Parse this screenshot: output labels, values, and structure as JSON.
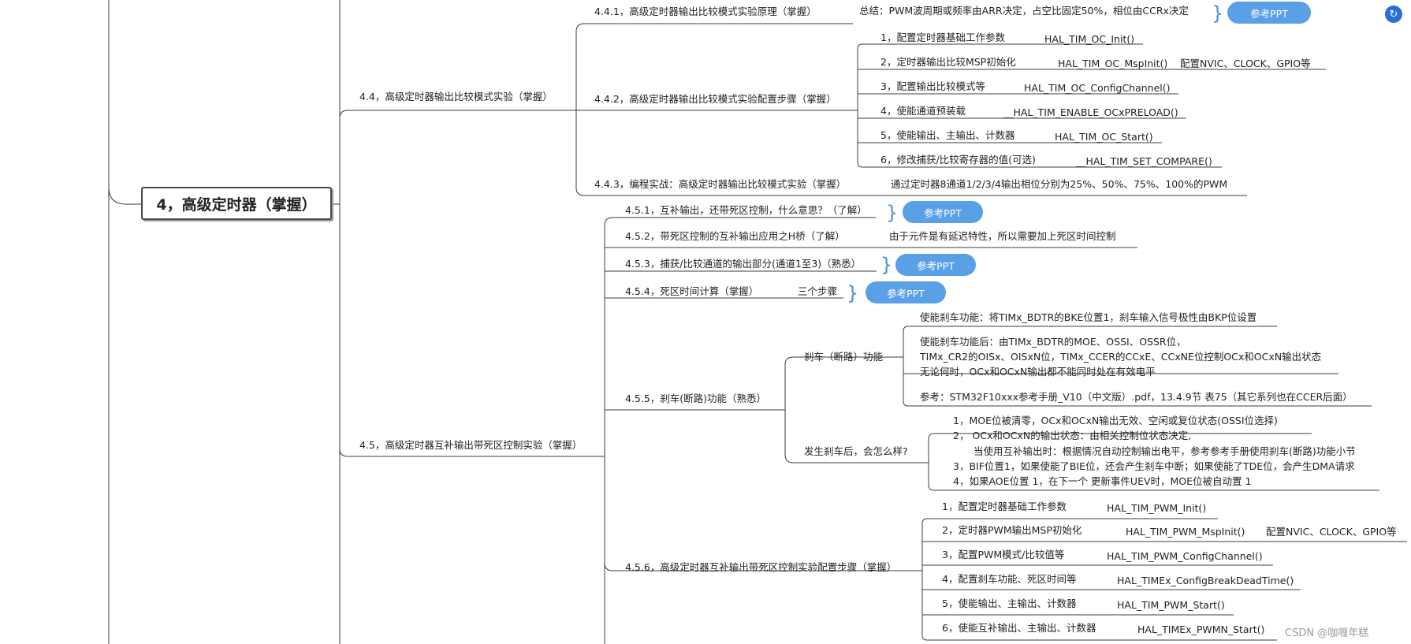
{
  "root": {
    "label": "4，高级定时器（掌握）"
  },
  "s44": {
    "label": "4.4，高级定时器输出比较模式实验（掌握）",
    "n441": {
      "label": "4.4.1，高级定时器输出比较模式实验原理（掌握）",
      "summary": "总结：PWM波周期或频率由ARR决定，占空比固定50%，相位由CCRx决定",
      "ppt": "参考PPT"
    },
    "n442": {
      "label": "4.4.2，高级定时器输出比较模式实验配置步骤（掌握）",
      "steps": [
        {
          "label": "1，配置定时器基础工作参数",
          "func": "HAL_TIM_OC_Init()",
          "note": ""
        },
        {
          "label": "2，定时器输出比较MSP初始化",
          "func": "HAL_TIM_OC_MspInit()",
          "note": "配置NVIC、CLOCK、GPIO等"
        },
        {
          "label": "3，配置输出比较模式等",
          "func": "HAL_TIM_OC_ConfigChannel()",
          "note": ""
        },
        {
          "label": "4，使能通道预装载",
          "func": "__HAL_TIM_ENABLE_OCxPRELOAD()",
          "note": ""
        },
        {
          "label": "5，使能输出、主输出、计数器",
          "func": "HAL_TIM_OC_Start()",
          "note": ""
        },
        {
          "label": "6，修改捕获/比较寄存器的值(可选)",
          "func": "__HAL_TIM_SET_COMPARE()",
          "note": ""
        }
      ]
    },
    "n443": {
      "label": "4.4.3，编程实战：高级定时器输出比较模式实验（掌握）",
      "note": "通过定时器8通道1/2/3/4输出相位分别为25%、50%、75%、100%的PWM"
    }
  },
  "s45": {
    "label": "4.5，高级定时器互补输出带死区控制实验（掌握）",
    "n451": {
      "label": "4.5.1，互补输出，还带死区控制，什么意思？（了解）",
      "ppt": "参考PPT"
    },
    "n452": {
      "label": "4.5.2，带死区控制的互补输出应用之H桥（了解）",
      "note": "由于元件是有延迟特性，所以需要加上死区时间控制"
    },
    "n453": {
      "label": "4.5.3，捕获/比较通道的输出部分(通道1至3)（熟悉）",
      "ppt": "参考PPT"
    },
    "n454": {
      "label": "4.5.4，死区时间计算（掌握）",
      "note": "三个步骤",
      "ppt": "参考PPT"
    },
    "n455": {
      "label": "4.5.5，刹车(断路)功能（熟悉）",
      "brake": {
        "label": "刹车（断路）功能",
        "items": [
          "使能刹车功能：将TIMx_BDTR的BKE位置1，刹车输入信号极性由BKP位设置",
          "使能刹车功能后：由TIMx_BDTR的MOE、OSSI、OSSR位，",
          "TIMx_CR2的OISx、OISxN位，TIMx_CCER的CCxE、CCxNE位控制OCx和OCxN输出状态",
          "无论何时，OCx和OCxN输出都不能同时处在有效电平",
          "参考：STM32F10xxx参考手册_V10（中文版）.pdf，13.4.9节 表75（其它系列也在CCER后面）"
        ]
      },
      "after": {
        "label": "发生刹车后，会怎么样?",
        "items": [
          "1，MOE位被清零，OCx和OCxN输出无效、空闲或复位状态(OSSI位选择)",
          "2，  OCx和OCxN的输出状态：由相关控制位状态决定,",
          "当使用互补输出时：根据情况自动控制输出电平，参考参考手册使用刹车(断路)功能小节",
          "3，BIF位置1，如果使能了BIE位，还会产生刹车中断；如果使能了TDE位，会产生DMA请求",
          "4，如果AOE位置 1，在下一个 更新事件UEV时，MOE位被自动置 1"
        ]
      }
    },
    "n456": {
      "label": "4.5.6，高级定时器互补输出带死区控制实验配置步骤（掌握）",
      "steps": [
        {
          "label": "1，配置定时器基础工作参数",
          "func": "HAL_TIM_PWM_Init()",
          "note": ""
        },
        {
          "label": "2，定时器PWM输出MSP初始化",
          "func": "HAL_TIM_PWM_MspInit()",
          "note": "配置NVIC、CLOCK、GPIO等"
        },
        {
          "label": "3，配置PWM模式/比较值等",
          "func": "HAL_TIM_PWM_ConfigChannel()",
          "note": ""
        },
        {
          "label": "4，配置刹车功能、死区时间等",
          "func": "HAL_TIMEx_ConfigBreakDeadTime()",
          "note": ""
        },
        {
          "label": "5，使能输出、主输出、计数器",
          "func": "HAL_TIM_PWM_Start()",
          "note": ""
        },
        {
          "label": "6，使能互补输出、主输出、计数器",
          "func": "HAL_TIMEx_PWMN_Start()",
          "note": ""
        }
      ]
    }
  },
  "watermark": "CSDN @咖喱年糕",
  "colors": {
    "line": "#3c3c3c",
    "ppt_bg": "#5aa0e6",
    "brace": "#4a90d9",
    "corner_icon": "#2b6fd6"
  },
  "icons": {
    "corner": "refresh-icon"
  }
}
